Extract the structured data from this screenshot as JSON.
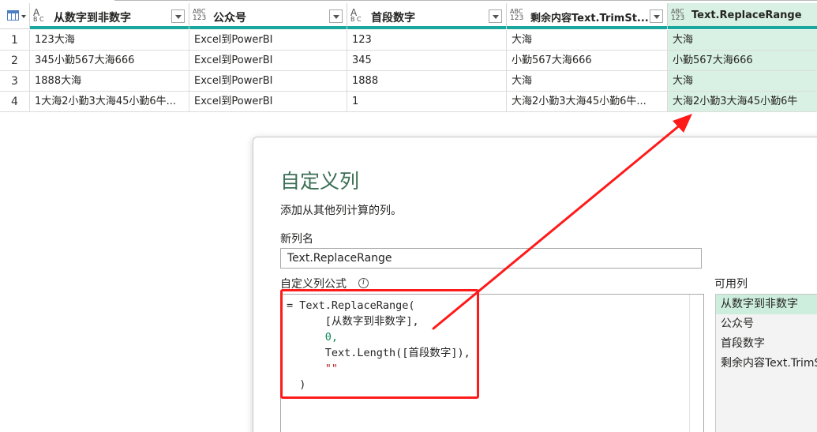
{
  "grid": {
    "columns": [
      {
        "label": "从数字到非数字",
        "type_top": "A",
        "type_bottom": "B C"
      },
      {
        "label": "公众号",
        "type_top": "ABC",
        "type_bottom": "123"
      },
      {
        "label": "首段数字",
        "type_top": "A",
        "type_bottom": "B C"
      },
      {
        "label": "剩余内容Text.TrimSt...",
        "type_top": "ABC",
        "type_bottom": "123"
      },
      {
        "label": "Text.ReplaceRange",
        "type_top": "ABC",
        "type_bottom": "123"
      }
    ],
    "rows": [
      {
        "num": "1",
        "cells": [
          "123大海",
          "Excel到PowerBI",
          "123",
          "大海",
          "大海"
        ]
      },
      {
        "num": "2",
        "cells": [
          "345小勤567大海666",
          "Excel到PowerBI",
          "345",
          "小勤567大海666",
          "小勤567大海666"
        ]
      },
      {
        "num": "3",
        "cells": [
          "1888大海",
          "Excel到PowerBI",
          "1888",
          "大海",
          "大海"
        ]
      },
      {
        "num": "4",
        "cells": [
          "1大海2小勤3大海45小勤6牛...",
          "Excel到PowerBI",
          "1",
          "大海2小勤3大海45小勤6牛...",
          "大海2小勤3大海45小勤6牛"
        ]
      }
    ]
  },
  "dialog": {
    "title": "自定义列",
    "subtitle": "添加从其他列计算的列。",
    "new_col_label": "新列名",
    "new_col_value": "Text.ReplaceRange",
    "formula_label": "自定义列公式",
    "info_icon_glyph": "i",
    "formula_lines": [
      "= Text.ReplaceRange(",
      "      [从数字到非数字],",
      "      0,",
      "      Text.Length([首段数字]),",
      "      \"\"",
      "  )"
    ],
    "available_label": "可用列",
    "available_columns": [
      "从数字到非数字",
      "公众号",
      "首段数字",
      "剩余内容Text.TrimSt"
    ]
  },
  "colors": {
    "accent_teal": "#1aa79e",
    "selected_green": "#d9f1e4",
    "title_green": "#3a6e54",
    "highlight_red": "#ff1a1a"
  }
}
